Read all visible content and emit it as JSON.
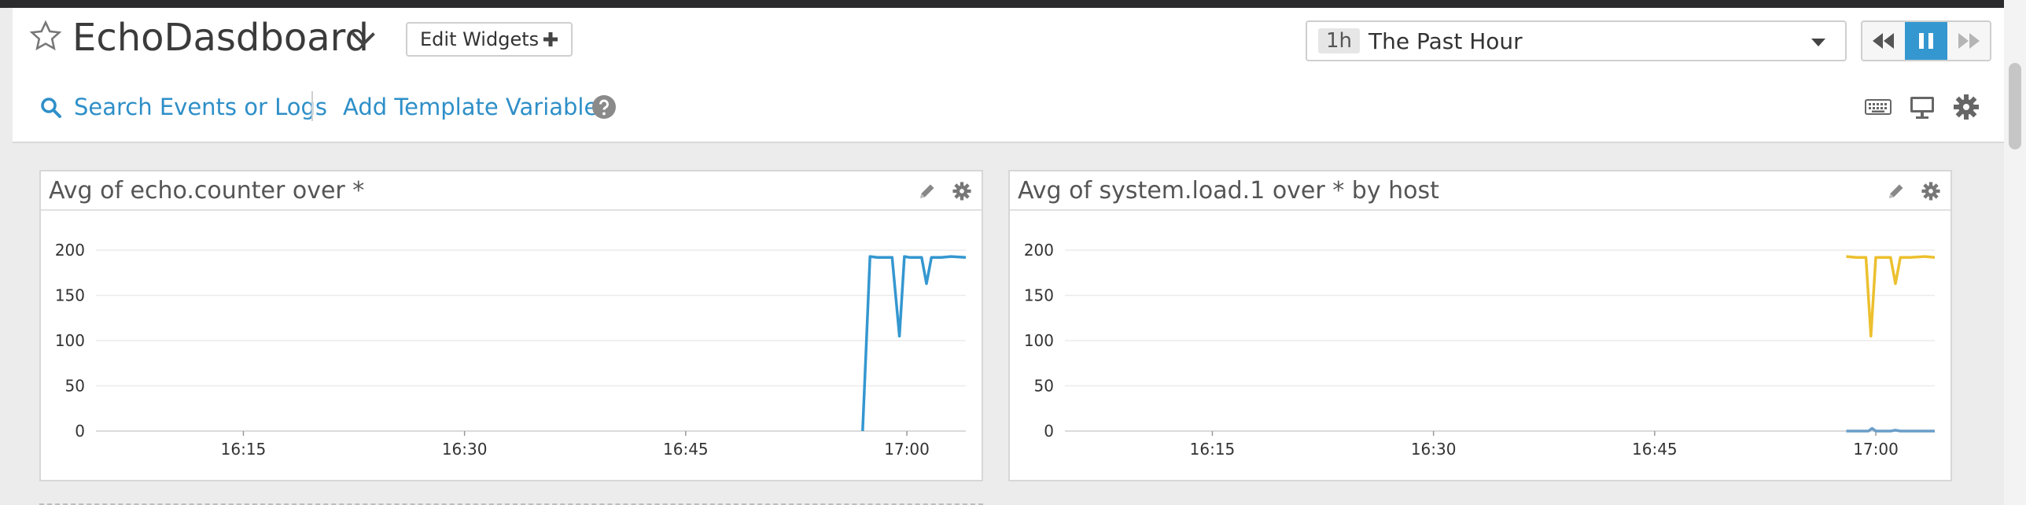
{
  "dashboard": {
    "title": "EchoDasdboard",
    "edit_widgets_label": "Edit Widgets"
  },
  "timeframe": {
    "chip": "1h",
    "label": "The Past Hour"
  },
  "toolbar": {
    "search_label": "Search Events or Logs",
    "template_vars_label": "Add Template Variables"
  },
  "icons": {
    "favorite": "star-icon",
    "dropdown": "chevron-down-icon",
    "add": "plus-icon",
    "search": "search-icon",
    "help": "help-icon",
    "keyboard": "keyboard-icon",
    "tv_mode": "monitor-icon",
    "settings": "gear-icon",
    "rewind": "rewind-icon",
    "pause": "pause-icon",
    "forward": "fast-forward-icon",
    "edit": "pencil-icon"
  },
  "colors": {
    "accent": "#3497d0",
    "link": "#2e8fc8",
    "series_blue": "#3497d0",
    "series_yellow": "#ecc02e",
    "series_host_b": "#6a9ec9"
  },
  "widgets": [
    {
      "title": "Avg of echo.counter over *",
      "chart_data": {
        "type": "line",
        "x_ticks": [
          "16:15",
          "16:30",
          "16:45",
          "17:00"
        ],
        "x_range": [
          "16:05",
          "17:04"
        ],
        "ylim": [
          0,
          200
        ],
        "y_ticks": [
          0,
          50,
          100,
          150,
          200
        ],
        "grid": true,
        "series": [
          {
            "color": "#3497d0",
            "x": [
              "16:57:00",
              "16:57:30",
              "16:58:00",
              "16:59:00",
              "16:59:30",
              "16:59:50",
              "17:00:10",
              "17:01:00",
              "17:01:20",
              "17:01:40",
              "17:02:20",
              "17:03:00",
              "17:04:00"
            ],
            "values": [
              0,
              193,
              192,
              192,
              105,
              193,
              192,
              192,
              163,
              192,
              192,
              193,
              192
            ]
          }
        ]
      }
    },
    {
      "title": "Avg of system.load.1 over * by host",
      "chart_data": {
        "type": "line",
        "x_ticks": [
          "16:15",
          "16:30",
          "16:45",
          "17:00"
        ],
        "x_range": [
          "16:05",
          "17:04"
        ],
        "ylim": [
          0,
          200
        ],
        "y_ticks": [
          0,
          50,
          100,
          150,
          200
        ],
        "grid": true,
        "series": [
          {
            "color": "#ecc02e",
            "x": [
              "16:58:00",
              "16:58:40",
              "16:59:20",
              "16:59:40",
              "17:00:00",
              "17:01:00",
              "17:01:20",
              "17:01:40",
              "17:02:20",
              "17:03:20",
              "17:04:00"
            ],
            "values": [
              193,
              192,
              192,
              105,
              192,
              192,
              163,
              192,
              192,
              193,
              192
            ]
          },
          {
            "color": "#6a9ec9",
            "x": [
              "16:58:00",
              "16:59:30",
              "16:59:45",
              "17:00:00",
              "17:01:00",
              "17:01:20",
              "17:01:40",
              "17:04:00"
            ],
            "values": [
              0,
              0,
              3,
              0,
              0,
              1,
              0,
              0
            ]
          }
        ]
      }
    }
  ]
}
